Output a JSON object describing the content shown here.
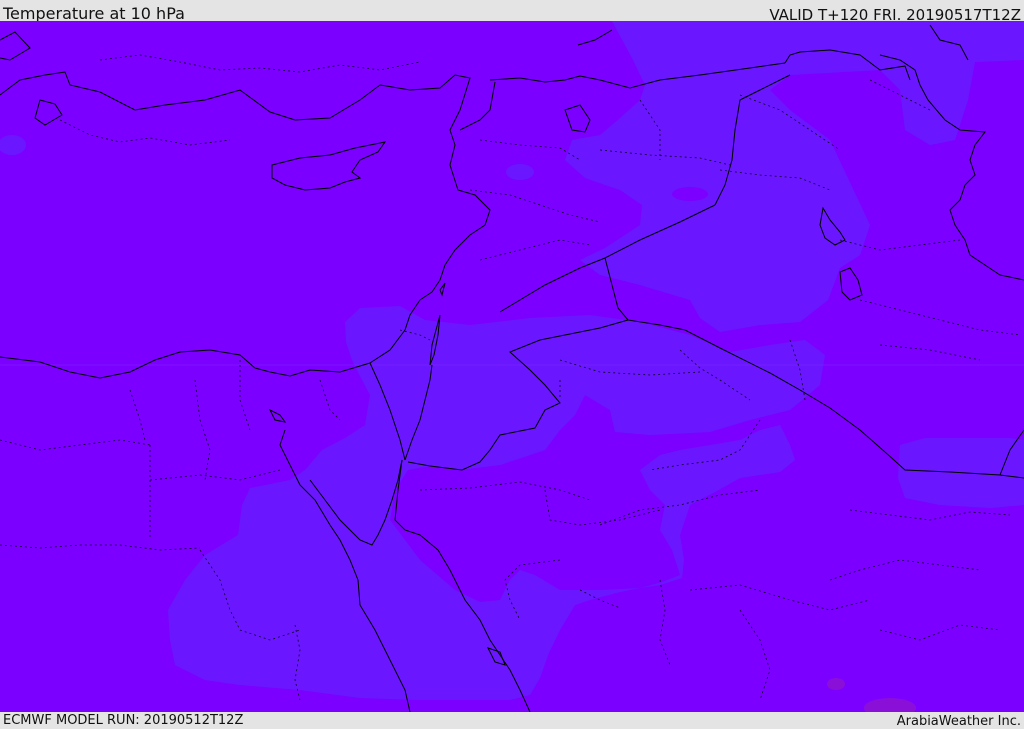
{
  "header": {
    "title": "Temperature at 10 hPa",
    "valid_time": "VALID T+120 FRI. 20190517T12Z"
  },
  "footer": {
    "model_run": "ECMWF MODEL RUN: 20190512T12Z",
    "credit": "ArabiaWeather Inc."
  },
  "map": {
    "colors": {
      "background_field": "#7b00ff",
      "warmer_field": "#6a17ff",
      "warm_spot": "#8a10d8",
      "coastline": "#000000",
      "border": "#000000"
    }
  }
}
